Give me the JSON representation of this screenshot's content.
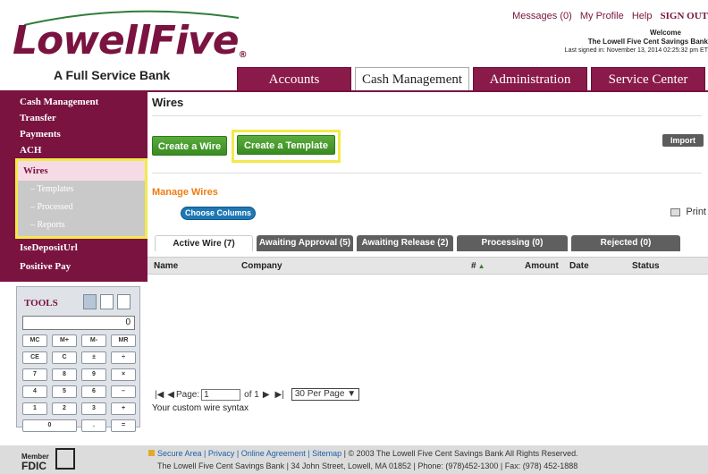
{
  "bank": {
    "name": "LowellFive",
    "tagline": "A Full Service Bank",
    "brand_color": "#7a1340"
  },
  "top_links": {
    "messages": "Messages (0)",
    "profile": "My Profile",
    "help": "Help",
    "signout": "SIGN OUT"
  },
  "welcome": {
    "greeting": "Welcome",
    "company": "The Lowell Five Cent Savings Bank",
    "last_signed": "Last signed in: November 13, 2014 02:25:32 pm ET"
  },
  "tabs": [
    "Accounts",
    "Cash Management",
    "Administration",
    "Service Center"
  ],
  "sidebar": {
    "items": [
      "Cash Management",
      "Transfer",
      "Payments",
      "ACH"
    ],
    "wires": {
      "label": "Wires",
      "children": [
        "– Templates",
        "– Processed",
        "– Reports"
      ]
    },
    "ise": "IseDepositUrl",
    "positive_pay": "Positive Pay"
  },
  "tools": {
    "title": "TOOLS",
    "display": "0",
    "keys": [
      "MC",
      "M+",
      "M-",
      "MR",
      "CE",
      "C",
      "±",
      "÷",
      "7",
      "8",
      "9",
      "×",
      "4",
      "5",
      "6",
      "–",
      "1",
      "2",
      "3",
      "+",
      "0",
      ".",
      "="
    ]
  },
  "main": {
    "title": "Wires",
    "create_wire": "Create a Wire",
    "create_template": "Create a Template",
    "import": "Import",
    "manage_title": "Manage Wires",
    "choose_columns": "Choose Columns",
    "print": "Print",
    "wire_tabs": [
      "Active Wire (7)",
      "Awaiting Approval (5)",
      "Awaiting Release (2)",
      "Processing (0)",
      "Rejected (0)"
    ],
    "columns": [
      "Name",
      "Company",
      "#",
      "Amount",
      "Date",
      "Status"
    ],
    "pager": {
      "page_label": "Page:",
      "page_value": "1",
      "of": "of 1",
      "per_page": "30 Per Page"
    },
    "custom_syntax": "Your custom wire syntax"
  },
  "footer": {
    "member": "Member",
    "fdic": "FDIC",
    "links": "Secure Area  |  Privacy  |  Online Agreement  |  Sitemap",
    "copyright": "© 2003 The Lowell Five Cent Savings Bank All Rights Reserved.",
    "address": "The Lowell Five Cent Savings Bank   |   34 John Street, Lowell, MA 01852   |   Phone: (978)452-1300   |   Fax: (978) 452-1888"
  }
}
